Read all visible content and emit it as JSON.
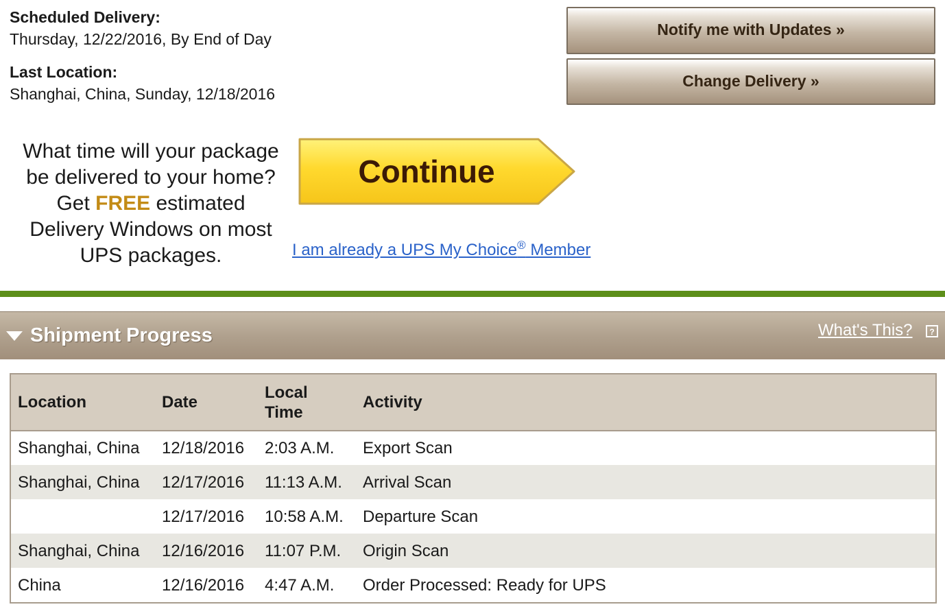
{
  "summary": {
    "scheduled_label": "Scheduled Delivery:",
    "scheduled_value": "Thursday, 12/22/2016, By End of Day",
    "last_location_label": "Last Location:",
    "last_location_value": "Shanghai, China, Sunday, 12/18/2016"
  },
  "actions": {
    "notify_label": "Notify me with Updates »",
    "change_label": "Change Delivery »"
  },
  "promo": {
    "line1": "What time will your package",
    "line2": "be delivered to your home?",
    "line3_pre": "Get ",
    "line3_free": "FREE",
    "line3_post": " estimated",
    "line4": "Delivery Windows on most",
    "line5": "UPS packages.",
    "continue_label": "Continue",
    "member_link_pre": "I am already a UPS My Choice",
    "member_link_reg": "®",
    "member_link_post": " Member"
  },
  "progress": {
    "title": "Shipment Progress",
    "whats_this": "What's This?",
    "icon_toggle": "triangle-down-icon",
    "icon_help": "help-icon",
    "columns": [
      "Location",
      "Date",
      "Local Time",
      "Activity"
    ],
    "rows": [
      {
        "location": "Shanghai, China",
        "date": "12/18/2016",
        "time": "2:03 A.M.",
        "activity": "Export Scan"
      },
      {
        "location": "Shanghai, China",
        "date": "12/17/2016",
        "time": "11:13 A.M.",
        "activity": "Arrival Scan"
      },
      {
        "location": "",
        "date": "12/17/2016",
        "time": "10:58 A.M.",
        "activity": "Departure Scan"
      },
      {
        "location": "Shanghai, China",
        "date": "12/16/2016",
        "time": "11:07 P.M.",
        "activity": "Origin Scan"
      },
      {
        "location": "China",
        "date": "12/16/2016",
        "time": "4:47 A.M.",
        "activity": "Order Processed: Ready for UPS"
      }
    ]
  },
  "colors": {
    "accent_green": "#5d8f1a",
    "free_highlight": "#c38b16",
    "link_blue": "#2a62c9",
    "header_brown": "#b0a18e",
    "continue_yellow": "#fdd835"
  }
}
